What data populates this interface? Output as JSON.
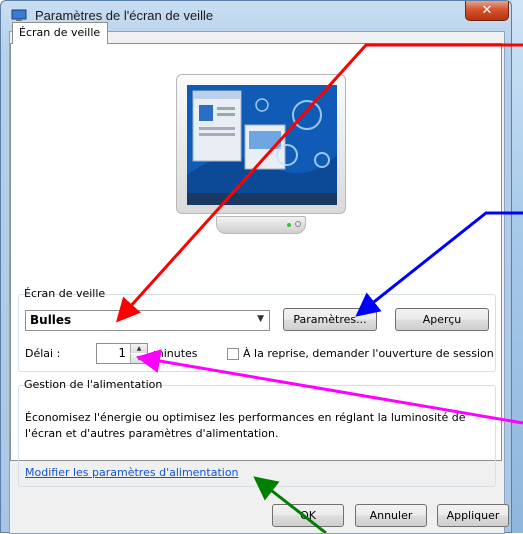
{
  "window": {
    "title": "Paramètres de l'écran de veille",
    "close_glyph": "✕"
  },
  "tabs": [
    {
      "label": "Écran de veille"
    }
  ],
  "screensaver": {
    "group_label": "Écran de veille",
    "selected": "Bulles",
    "settings_button": "Paramètres...",
    "preview_button": "Aperçu",
    "delay_label": "Délai :",
    "delay_value": "1",
    "minutes_label": "minutes",
    "resume_label": "À la reprise, demander l'ouverture de session"
  },
  "power": {
    "group_label": "Gestion de l'alimentation",
    "description": "Économisez l'énergie ou optimisez les performances en réglant la luminosité de l'écran et d'autres paramètres d'alimentation.",
    "link": "Modifier les paramètres d'alimentation"
  },
  "footer": {
    "ok": "OK",
    "cancel": "Annuler",
    "apply": "Appliquer"
  },
  "icons": {
    "app": "monitor-icon",
    "spin_up": "up-arrow-icon",
    "spin_down": "down-arrow-icon",
    "combo": "chevron-down-icon"
  },
  "annotation_colors": {
    "red": "#ff0000",
    "blue": "#0000ff",
    "magenta": "#ff00ff",
    "green": "#007f00"
  }
}
